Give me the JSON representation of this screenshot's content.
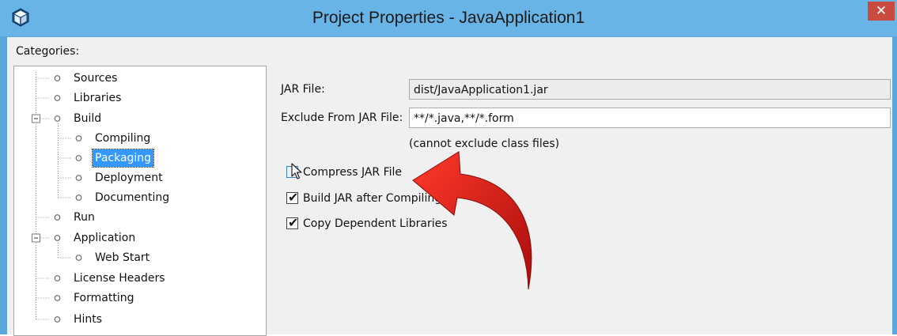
{
  "window": {
    "title": "Project Properties - JavaApplication1",
    "close_label": "✕"
  },
  "categories": {
    "label": "Categories:",
    "items": [
      {
        "label": "Sources"
      },
      {
        "label": "Libraries"
      },
      {
        "label": "Build"
      },
      {
        "label": "Compiling"
      },
      {
        "label": "Packaging"
      },
      {
        "label": "Deployment"
      },
      {
        "label": "Documenting"
      },
      {
        "label": "Run"
      },
      {
        "label": "Application"
      },
      {
        "label": "Web Start"
      },
      {
        "label": "License Headers"
      },
      {
        "label": "Formatting"
      },
      {
        "label": "Hints"
      }
    ],
    "selected": "Packaging"
  },
  "packaging": {
    "jar_file_label": "JAR File:",
    "jar_file_value": "dist/JavaApplication1.jar",
    "exclude_label": "Exclude From JAR File:",
    "exclude_value": "**/*.java,**/*.form",
    "exclude_hint": "(cannot exclude class files)",
    "options": [
      {
        "label": "Compress JAR File",
        "checked": false
      },
      {
        "label": "Build JAR after Compiling",
        "checked": true
      },
      {
        "label": "Copy Dependent Libraries",
        "checked": true
      }
    ]
  },
  "colors": {
    "titlebar": "#69b4e6",
    "selection": "#3399ff",
    "close_button": "#c94a3f",
    "annotation_arrow": "#d01515"
  },
  "icons": [
    "netbeans-app-icon",
    "close-icon",
    "mouse-pointer-icon",
    "curved-arrow-icon"
  ]
}
